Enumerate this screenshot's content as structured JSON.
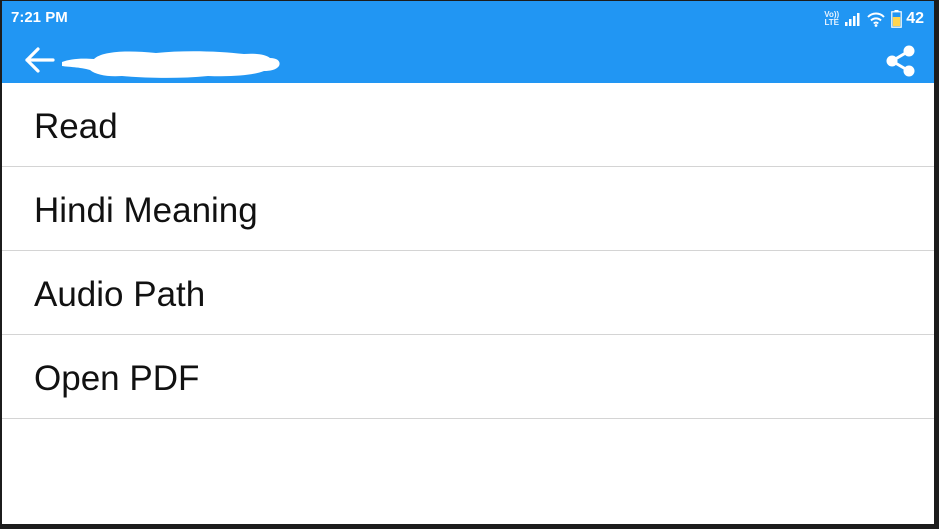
{
  "status_bar": {
    "time": "7:21 PM",
    "volte_top": "Vo))",
    "volte_bottom": "LTE",
    "battery_level": "42",
    "icons": [
      "volte-icon",
      "signal-icon",
      "wifi-icon",
      "battery-icon"
    ]
  },
  "toolbar": {
    "back_icon": "arrow-left-icon",
    "share_icon": "share-icon"
  },
  "menu": {
    "items": [
      {
        "label": "Read"
      },
      {
        "label": "Hindi Meaning"
      },
      {
        "label": "Audio Path"
      },
      {
        "label": "Open PDF"
      }
    ]
  },
  "colors": {
    "primary": "#2196f3",
    "background": "#ffffff",
    "divider": "#d4d4d4",
    "text": "#111111",
    "battery_fill": "#ffd54f"
  }
}
